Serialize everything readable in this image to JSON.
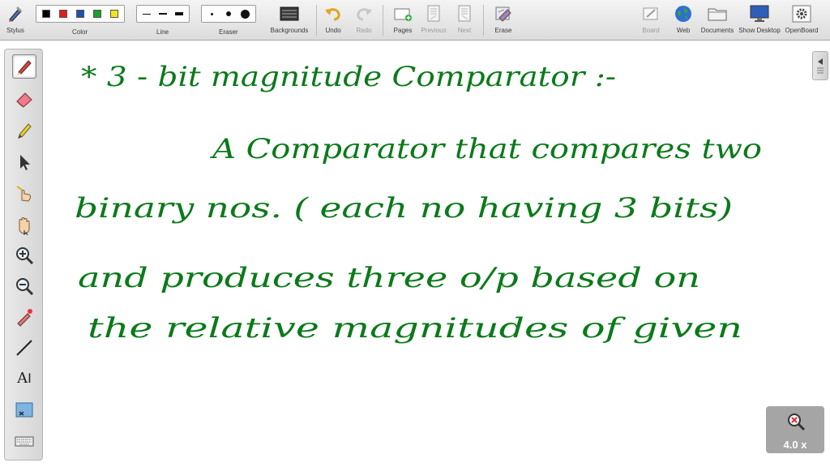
{
  "toolbar": {
    "stylus": "Stylus",
    "color": "Color",
    "line": "Line",
    "eraser": "Eraser",
    "backgrounds": "Backgrounds",
    "undo": "Undo",
    "redo": "Redo",
    "pages": "Pages",
    "previous": "Previous",
    "next": "Next",
    "erase": "Erase",
    "board": "Board",
    "web": "Web",
    "documents": "Documents",
    "show_desktop": "Show Desktop",
    "openboard": "OpenBoard"
  },
  "colors": {
    "palette": [
      "#000000",
      "#e31c1c",
      "#1f4fb4",
      "#19a02a",
      "#f5e31a"
    ],
    "ink": "#0b7a1a"
  },
  "left_tools": [
    "pen-icon",
    "eraser-icon",
    "marker-icon",
    "selector-icon",
    "interact-icon",
    "hand-icon",
    "zoom-in-icon",
    "zoom-out-icon",
    "laser-pointer-icon",
    "line-icon",
    "text-icon",
    "capture-icon",
    "keyboard-icon"
  ],
  "text_tool_label": "A",
  "board": {
    "lines": [
      "*     3 - bit magnitude Comparator :-",
      "A Comparator that compares two",
      "binary nos. ( each no having 3 bits)",
      "and produces three o/p based on",
      "the relative magnitudes of given"
    ]
  },
  "zoom": {
    "value": "4.0 x"
  }
}
